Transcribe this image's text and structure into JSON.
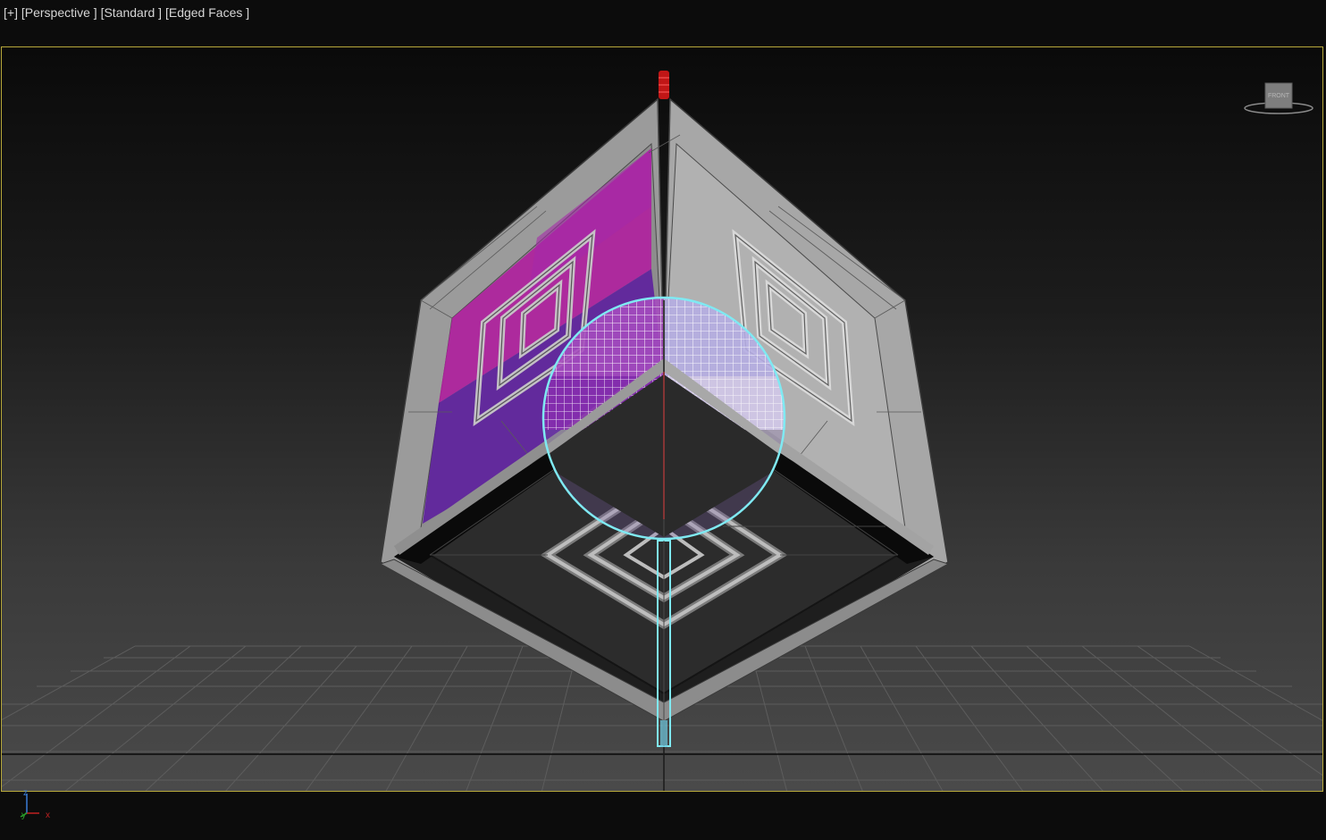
{
  "viewport": {
    "labels": [
      "[+]",
      "[Perspective ]",
      "[Standard ]",
      "[Edged Faces ]"
    ],
    "viewcube_face": "FRONT"
  },
  "axis": {
    "x": "x",
    "y": "y",
    "z": "z"
  },
  "colors": {
    "active_border": "#b7a83a",
    "selection": "#7fe9f2",
    "magenta_face": "#b01fa0",
    "purple_face": "#5a1f9a",
    "pivot_red": "#d01818"
  }
}
